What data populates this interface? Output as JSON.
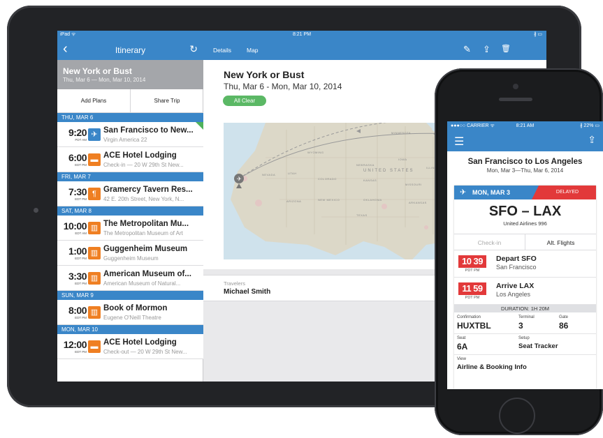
{
  "ipad": {
    "status": {
      "left": "iPad ᯤ",
      "time": "8:21 PM",
      "right": "∦ ▭"
    },
    "sidebar": {
      "nav_back": "‹",
      "nav_title": "Itinerary",
      "nav_refresh": "↻",
      "trip_title": "New York or Bust",
      "trip_dates": "Thu, Mar 6 — Mon, Mar 10, 2014",
      "add_plans": "Add Plans",
      "share_trip": "Share Trip",
      "days": [
        {
          "header": "THU, MAR 6",
          "items": [
            {
              "time": "9:20",
              "zone": "PDT AM",
              "icon": "airplane-icon",
              "glyph": "✈",
              "color": "blue",
              "title": "San Francisco to New...",
              "sub": "Virgin America 22"
            },
            {
              "time": "6:00",
              "zone": "EDT PM",
              "icon": "bed-icon",
              "glyph": "▬",
              "color": "orange",
              "title": "ACE Hotel Lodging",
              "sub": "Check-in — 20 W 29th St New..."
            }
          ]
        },
        {
          "header": "FRI, MAR 7",
          "items": [
            {
              "time": "7:30",
              "zone": "EDT PM",
              "icon": "fork-knife-icon",
              "glyph": "¶",
              "color": "orange",
              "title": "Gramercy Tavern Res...",
              "sub": "42 E. 20th Street, New York, N..."
            }
          ]
        },
        {
          "header": "SAT, MAR 8",
          "items": [
            {
              "time": "10:00",
              "zone": "EDT AM",
              "icon": "museum-icon",
              "glyph": "▥",
              "color": "orange",
              "title": "The Metropolitan Mu...",
              "sub": "The Metropolitan Museum of Art"
            },
            {
              "time": "1:00",
              "zone": "EDT PM",
              "icon": "museum-icon",
              "glyph": "▥",
              "color": "orange",
              "title": "Guggenheim Museum",
              "sub": "Guggenheim Museum"
            },
            {
              "time": "3:30",
              "zone": "EDT PM",
              "icon": "museum-icon",
              "glyph": "▥",
              "color": "orange",
              "title": "American Museum of...",
              "sub": "American Museum of Natural..."
            }
          ]
        },
        {
          "header": "SUN, MAR 9",
          "items": [
            {
              "time": "8:00",
              "zone": "EDT PM",
              "icon": "museum-icon",
              "glyph": "▥",
              "color": "orange",
              "title": "Book of Mormon",
              "sub": "Eugene O'Neill Theatre"
            }
          ]
        },
        {
          "header": "MON, MAR 10",
          "items": [
            {
              "time": "12:00",
              "zone": "EDT PM",
              "icon": "bed-icon",
              "glyph": "▬",
              "color": "orange",
              "title": "ACE Hotel Lodging",
              "sub": "Check-out — 20 W 29th St New..."
            }
          ]
        }
      ]
    },
    "detail": {
      "tab_details": "Details",
      "tab_map": "Map",
      "edit_icon": "✎",
      "share_icon": "⇪",
      "trash_icon": "🗑",
      "title": "New York or Bust",
      "dates": "Thu, Mar 6 - Mon, Mar 10, 2014",
      "status": "All Clear",
      "map_labels": [
        "WYOMING",
        "NEBRASKA",
        "UNITED STATES",
        "KANSAS",
        "OKLAHOMA",
        "TEXAS",
        "ILLINOIS",
        "MISSOURI",
        "COLORADO",
        "NEVADA",
        "UTAH",
        "ARIZONA",
        "MINNESOTA",
        "IOWA",
        "TENNESSEE",
        "ARKANSAS",
        "NEW MEXICO"
      ],
      "travelers_label": "Travelers",
      "travelers_name": "Michael Smith"
    }
  },
  "iphone": {
    "status": {
      "left": "●●●○○ CARRIER ᯤ",
      "time": "8:21 AM",
      "right": "∦ 22% ▭"
    },
    "menu_icon": "☰",
    "share_icon": "⇪",
    "trip_title": "San Francisco to Los Angeles",
    "trip_dates": "Mon, Mar 3—Thu, Mar 6, 2014",
    "card": {
      "plane_icon": "✈",
      "date": "MON, MAR 3",
      "status": "DELAYED",
      "route": "SFO – LAX",
      "airline": "United Airlines 996",
      "checkin": "Check-in",
      "alt_flights": "Alt. Flights",
      "depart": {
        "time": "10 39",
        "zone": "PDT PM",
        "title": "Depart SFO",
        "sub": "San Francisco"
      },
      "arrive": {
        "time": "11 59",
        "zone": "PDT PM",
        "title": "Arrive LAX",
        "sub": "Los Angeles"
      },
      "duration": "DURATION: 1H 20M",
      "confirmation_label": "Confirmation",
      "confirmation": "HUXTBL",
      "terminal_label": "Terminal",
      "terminal": "3",
      "gate_label": "Gate",
      "gate": "86",
      "seat_label": "Seat",
      "seat": "6A",
      "setup_label": "Setup",
      "setup": "Seat Tracker",
      "view_label": "View",
      "view": "Airline & Booking Info"
    }
  },
  "colors": {
    "accent": "#3a86c8",
    "orange": "#ef7f22",
    "delayed": "#e2393a",
    "clear": "#5bb865"
  }
}
